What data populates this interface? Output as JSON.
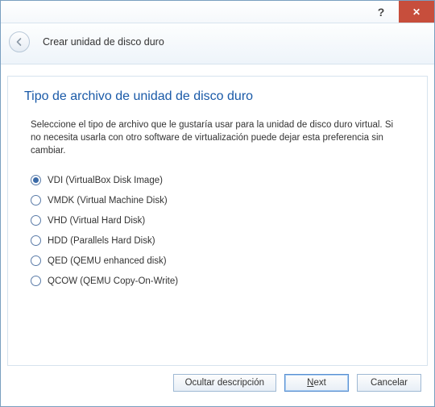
{
  "titlebar": {
    "help": "?",
    "close": "✕"
  },
  "header": {
    "title": "Crear unidad de disco duro"
  },
  "panel": {
    "heading": "Tipo de archivo de unidad de disco duro",
    "description": "Seleccione el tipo de archivo que le gustaría usar para la unidad de disco duro virtual. Si no necesita usarla con otro software de virtualización puede dejar esta preferencia sin cambiar.",
    "options": [
      {
        "label": "VDI (VirtualBox Disk Image)",
        "selected": true
      },
      {
        "label": "VMDK (Virtual Machine Disk)",
        "selected": false
      },
      {
        "label": "VHD (Virtual Hard Disk)",
        "selected": false
      },
      {
        "label": "HDD (Parallels Hard Disk)",
        "selected": false
      },
      {
        "label": "QED (QEMU enhanced disk)",
        "selected": false
      },
      {
        "label": "QCOW (QEMU Copy-On-Write)",
        "selected": false
      }
    ]
  },
  "footer": {
    "hide_desc": "Ocultar descripción",
    "next_prefix": "N",
    "next_rest": "ext",
    "cancel": "Cancelar"
  }
}
